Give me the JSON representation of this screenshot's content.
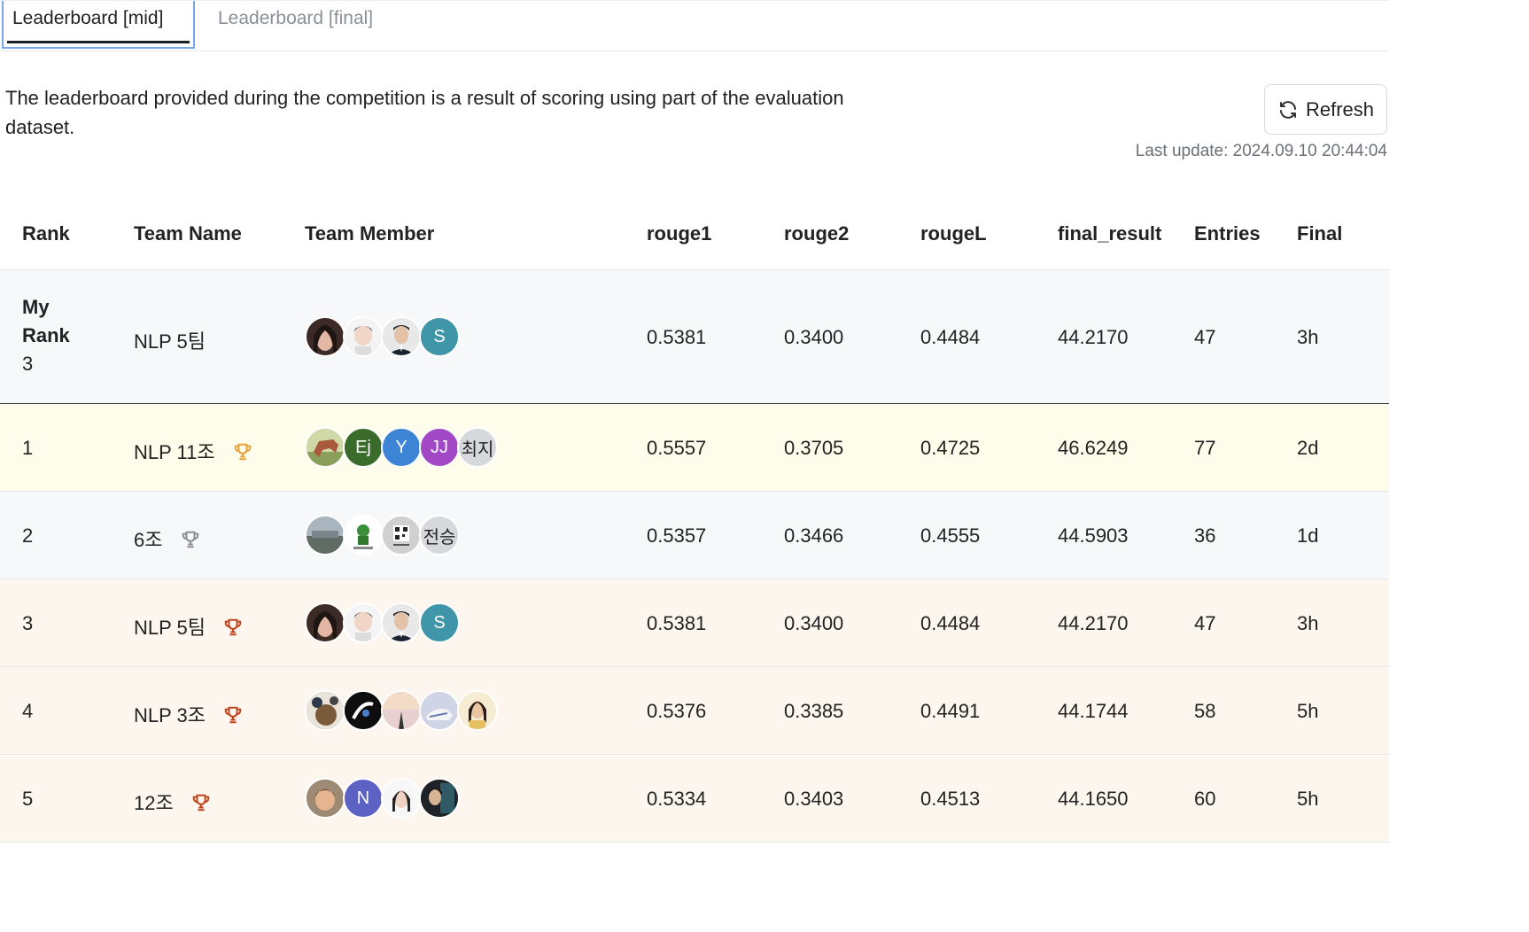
{
  "tabs": [
    {
      "label": "Leaderboard [mid]",
      "active": true
    },
    {
      "label": "Leaderboard [final]",
      "active": false
    }
  ],
  "notice": "The leaderboard provided during the competition is a result of scoring using part of the evaluation dataset.",
  "refresh": {
    "label": "Refresh",
    "icon": "refresh-icon"
  },
  "last_update": "Last update: 2024.09.10 20:44:04",
  "table": {
    "columns": [
      "Rank",
      "Team Name",
      "Team Member",
      "rouge1",
      "rouge2",
      "rougeL",
      "final_result",
      "Entries",
      "Final"
    ],
    "my_rank": {
      "label_line1": "My",
      "label_line2": "Rank",
      "rank": "3",
      "team": "NLP 5팀",
      "members": [
        "photo",
        "photo",
        "photo",
        "S"
      ],
      "rouge1": "0.5381",
      "rouge2": "0.3400",
      "rougeL": "0.4484",
      "final_result": "44.2170",
      "entries": "47",
      "final": "3h"
    },
    "rows": [
      {
        "rank": "1",
        "team": "NLP 11조",
        "trophy": "gold",
        "members": [
          "photo",
          "Ej",
          "Y",
          "JJ",
          "최지"
        ],
        "rouge1": "0.5557",
        "rouge2": "0.3705",
        "rougeL": "0.4725",
        "final_result": "46.6249",
        "entries": "77",
        "final": "2d"
      },
      {
        "rank": "2",
        "team": "6조",
        "trophy": "silver",
        "members": [
          "photo",
          "photo",
          "photo",
          "전승"
        ],
        "rouge1": "0.5357",
        "rouge2": "0.3466",
        "rougeL": "0.4555",
        "final_result": "44.5903",
        "entries": "36",
        "final": "1d"
      },
      {
        "rank": "3",
        "team": "NLP 5팀",
        "trophy": "bronze",
        "members": [
          "photo",
          "photo",
          "photo",
          "S"
        ],
        "rouge1": "0.5381",
        "rouge2": "0.3400",
        "rougeL": "0.4484",
        "final_result": "44.2170",
        "entries": "47",
        "final": "3h"
      },
      {
        "rank": "4",
        "team": "NLP 3조",
        "trophy": "bronze",
        "members": [
          "photo",
          "photo",
          "photo",
          "photo",
          "photo"
        ],
        "rouge1": "0.5376",
        "rouge2": "0.3385",
        "rougeL": "0.4491",
        "final_result": "44.1744",
        "entries": "58",
        "final": "5h"
      },
      {
        "rank": "5",
        "team": "12조",
        "trophy": "bronze",
        "members": [
          "photo",
          "N",
          "photo",
          "photo"
        ],
        "rouge1": "0.5334",
        "rouge2": "0.3403",
        "rougeL": "0.4513",
        "final_result": "44.1650",
        "entries": "60",
        "final": "5h"
      }
    ]
  },
  "colors": {
    "gold_trophy": "#e8a23a",
    "silver_trophy": "#8a8f96",
    "bronze_trophy": "#c0451e",
    "row1_bg": "#fefdec",
    "row_bronze_bg": "#fdf6ee",
    "my_rank_bg": "#f7f8fa",
    "tab_active_border": "#7aa5e8"
  }
}
